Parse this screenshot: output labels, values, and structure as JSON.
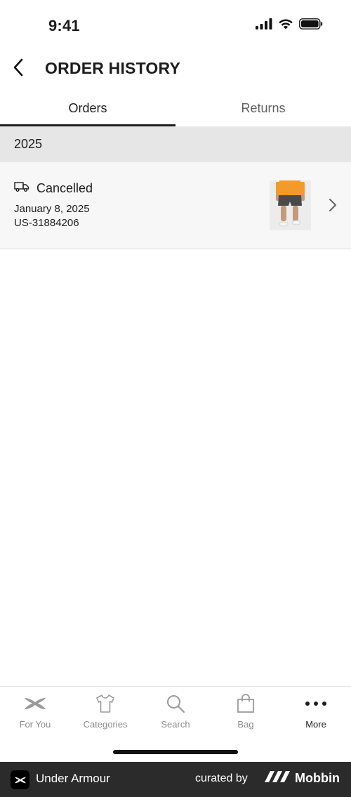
{
  "status_bar": {
    "time": "9:41",
    "icons": [
      "signal-icon",
      "wifi-icon",
      "battery-icon"
    ]
  },
  "header": {
    "back_icon": "chevron-left-icon",
    "title": "ORDER HISTORY"
  },
  "tabs": [
    {
      "label": "Orders",
      "active": true
    },
    {
      "label": "Returns",
      "active": false
    }
  ],
  "orders_section": {
    "year": "2025",
    "orders": [
      {
        "status_icon": "truck-icon",
        "status": "Cancelled",
        "date": "January 8, 2025",
        "order_number": "US-31884206",
        "thumbnail": "product-thumbnail-shorts",
        "chevron_icon": "chevron-right-icon"
      }
    ]
  },
  "bottom_nav": {
    "items": [
      {
        "label": "For You",
        "icon": "under-armour-logo-icon",
        "active": false
      },
      {
        "label": "Categories",
        "icon": "shirt-icon",
        "active": false
      },
      {
        "label": "Search",
        "icon": "search-icon",
        "active": false
      },
      {
        "label": "Bag",
        "icon": "bag-icon",
        "active": false
      },
      {
        "label": "More",
        "icon": "more-dots-icon",
        "active": true
      }
    ]
  },
  "footer": {
    "app_name": "Under Armour",
    "curated_by": "curated by",
    "brand": "Mobbin"
  },
  "colors": {
    "text": "#1d1d1d",
    "muted": "#8c8c8c",
    "section_bg": "#e6e6e6",
    "row_bg": "#f7f7f7",
    "footer_bg": "#2b2b2b"
  }
}
